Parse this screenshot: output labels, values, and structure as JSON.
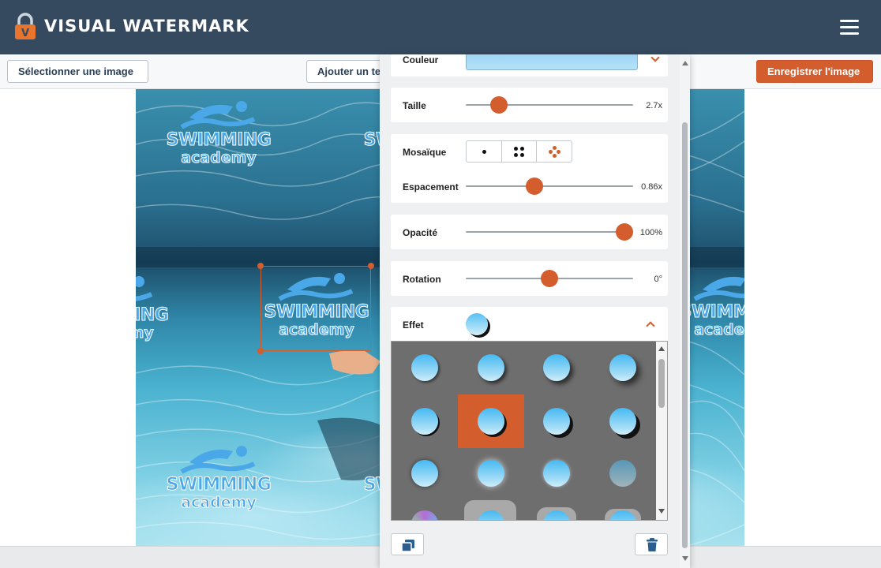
{
  "header": {
    "title": "VISUAL WATERMARK",
    "logo_icon": "padlock-v-logo",
    "menu_icon": "hamburger-menu-icon"
  },
  "toolbar": {
    "select_image": "Sélectionner une image",
    "add_text": "Ajouter un texte",
    "save_image": "Enregistrer l'image"
  },
  "watermark": {
    "line1": "SWIMMING",
    "line2": "academy",
    "color": "#4aa8e8"
  },
  "panel": {
    "color_label": "Couleur",
    "color_value": "#a8dcf7",
    "size": {
      "label": "Taille",
      "value": "2.7x",
      "fraction": 0.2
    },
    "tile": {
      "label": "Mosaïque",
      "options": [
        "single-dot-icon",
        "four-dots-icon",
        "scattered-dots-icon"
      ]
    },
    "spacing": {
      "label": "Espacement",
      "value": "0.86x",
      "fraction": 0.41
    },
    "opacity": {
      "label": "Opacité",
      "value": "100%",
      "fraction": 0.95
    },
    "rotation": {
      "label": "Rotation",
      "value": "0°",
      "fraction": 0.5
    },
    "effect": {
      "label": "Effet",
      "selected_index": 5
    },
    "accent": "#d45d2e"
  }
}
